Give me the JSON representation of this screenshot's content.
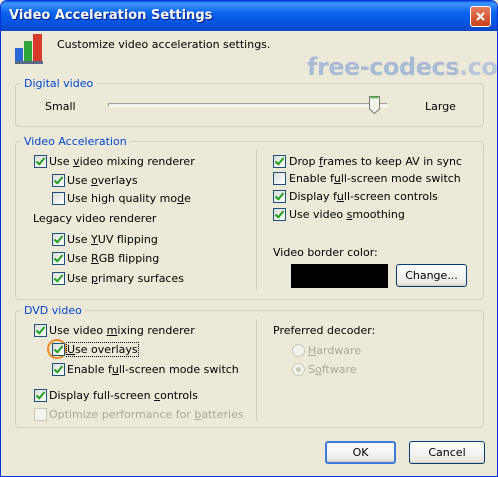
{
  "window": {
    "title": "Video Acceleration Settings"
  },
  "header": {
    "subtitle": "Customize video acceleration settings.",
    "brand_1": "free-codecs",
    "brand_2": ".com"
  },
  "digital_video": {
    "label": "Digital video",
    "small": "Small",
    "large": "Large",
    "slider_value_fraction": 0.97
  },
  "video_accel": {
    "label": "Video Acceleration",
    "left": [
      {
        "pre": "Use ",
        "key": "v",
        "post": "ideo mixing renderer",
        "checked": true
      },
      {
        "pre": "Use ",
        "key": "o",
        "post": "verlays",
        "checked": true
      },
      {
        "pre": "Use high quality mo",
        "key": "d",
        "post": "e",
        "checked": false
      }
    ],
    "legacy_label": "Legacy video renderer",
    "legacy": [
      {
        "pre": "Use ",
        "key": "Y",
        "post": "UV flipping",
        "checked": true
      },
      {
        "pre": "Use ",
        "key": "R",
        "post": "GB flipping",
        "checked": true
      },
      {
        "pre": "Use ",
        "key": "p",
        "post": "rimary surfaces",
        "checked": true
      }
    ],
    "right": [
      {
        "pre": "Drop ",
        "key": "f",
        "post": "rames to keep AV in sync",
        "checked": true
      },
      {
        "pre": "Enable f",
        "key": "u",
        "post": "ll-screen mode switch",
        "checked": false
      },
      {
        "pre": "Display f",
        "key": "u",
        "post": "ll-screen controls",
        "checked": true
      },
      {
        "pre": "Use video ",
        "key": "s",
        "post": "moothing",
        "checked": true
      }
    ],
    "border_color_label": "Video border color:",
    "border_color": "#000000",
    "change_pre": "Change",
    "change_post": "..."
  },
  "dvd": {
    "label": "DVD video",
    "items": [
      {
        "pre": "Use video ",
        "key": "m",
        "post": "ixing renderer",
        "checked": true
      },
      {
        "pre": "",
        "key": "U",
        "post": "se overlays",
        "checked": true
      },
      {
        "pre": "Enable f",
        "key": "u",
        "post": "ll-screen mode switch",
        "checked": true
      },
      {
        "pre": "Display full-screen ",
        "key": "c",
        "post": "ontrols",
        "checked": true
      },
      {
        "pre": "Optimize performance for ",
        "key": "b",
        "post": "atteries",
        "checked": false
      }
    ],
    "preferred_label": "Preferred decoder:",
    "decoders": [
      {
        "pre": "",
        "key": "H",
        "post": "ardware",
        "selected": false
      },
      {
        "pre": "S",
        "key": "o",
        "post": "ftware",
        "selected": true
      }
    ]
  },
  "buttons": {
    "ok": "OK",
    "cancel": "Cancel"
  },
  "colors": {
    "accent": "#0046d5",
    "title_bar": "#0a63ec",
    "focus_ring": "#ee8a28"
  }
}
